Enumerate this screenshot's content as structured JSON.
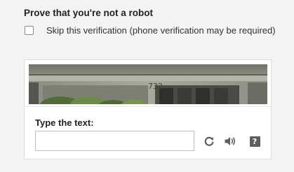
{
  "heading": "Prove that you're not a robot",
  "skip_option": {
    "label": "Skip this verification (phone verification may be required)",
    "checked": false
  },
  "captcha": {
    "image_text": "732",
    "type_label": "Type the text:",
    "input_value": "",
    "input_placeholder": "",
    "help_glyph": "?",
    "icons": [
      "reload-icon",
      "audio-icon",
      "help-icon"
    ]
  },
  "colors": {
    "page_background": "#f3f3f3",
    "box_background": "#ffffff",
    "icon_gray": "#5f5f5f"
  }
}
